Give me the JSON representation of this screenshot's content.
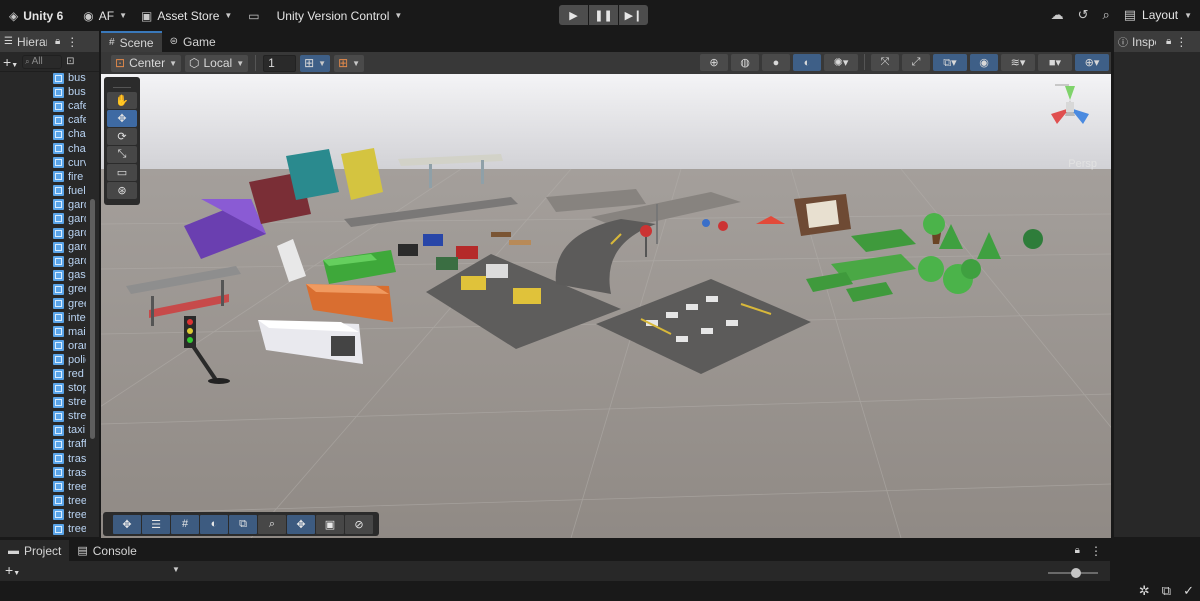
{
  "topbar": {
    "app_label": "Unity 6",
    "account_label": "AF",
    "asset_store_label": "Asset Store",
    "version_control_label": "Unity Version Control",
    "layout_label": "Layout"
  },
  "hierarchy": {
    "tab_label": "Hierarchy",
    "search_placeholder": "All",
    "items": [
      "bus",
      "bus",
      "cafe",
      "cafe",
      "chair",
      "chair",
      "curve",
      "fire",
      "fuel",
      "garden",
      "garden",
      "garden",
      "garden",
      "garden",
      "gas",
      "green",
      "green",
      "inter",
      "main",
      "orange",
      "police",
      "red",
      "stop",
      "street",
      "street",
      "taxi",
      "traffic",
      "trash",
      "trash",
      "tree",
      "tree",
      "tree",
      "tree"
    ]
  },
  "scene": {
    "tabs": [
      {
        "label": "Scene"
      },
      {
        "label": "Game"
      }
    ],
    "pivot_label": "Center",
    "space_label": "Local",
    "grid_snap_value": "1",
    "persp_label": "Persp"
  },
  "inspector": {
    "tab_label": "Inspector"
  },
  "project": {
    "tabs": [
      {
        "label": "Project"
      },
      {
        "label": "Console"
      }
    ],
    "zoom_level": 0.55
  }
}
